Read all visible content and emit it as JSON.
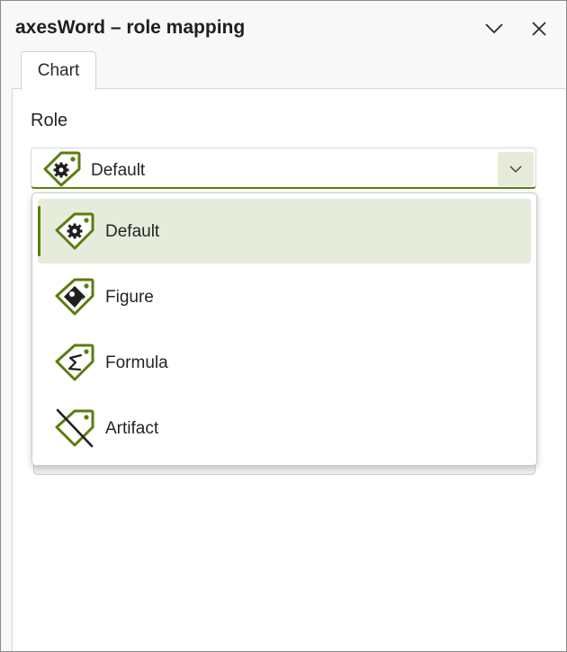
{
  "window": {
    "title": "axesWord – role mapping"
  },
  "titlebar": {
    "collapse_icon": "chevron-down-icon",
    "close_icon": "close-icon"
  },
  "tabs": [
    {
      "label": "Chart"
    }
  ],
  "role": {
    "label": "Role",
    "selected": "Default",
    "options": [
      {
        "label": "Default",
        "icon": "tag-gear-icon",
        "selected": true
      },
      {
        "label": "Figure",
        "icon": "tag-image-icon",
        "selected": false
      },
      {
        "label": "Formula",
        "icon": "tag-formula-icon",
        "selected": false
      },
      {
        "label": "Artifact",
        "icon": "tag-off-icon",
        "selected": false
      }
    ]
  },
  "colors": {
    "accent": "#5a7d0f",
    "selected_bg": "#e6ecdc",
    "arrow_bg": "#e5ead9"
  }
}
